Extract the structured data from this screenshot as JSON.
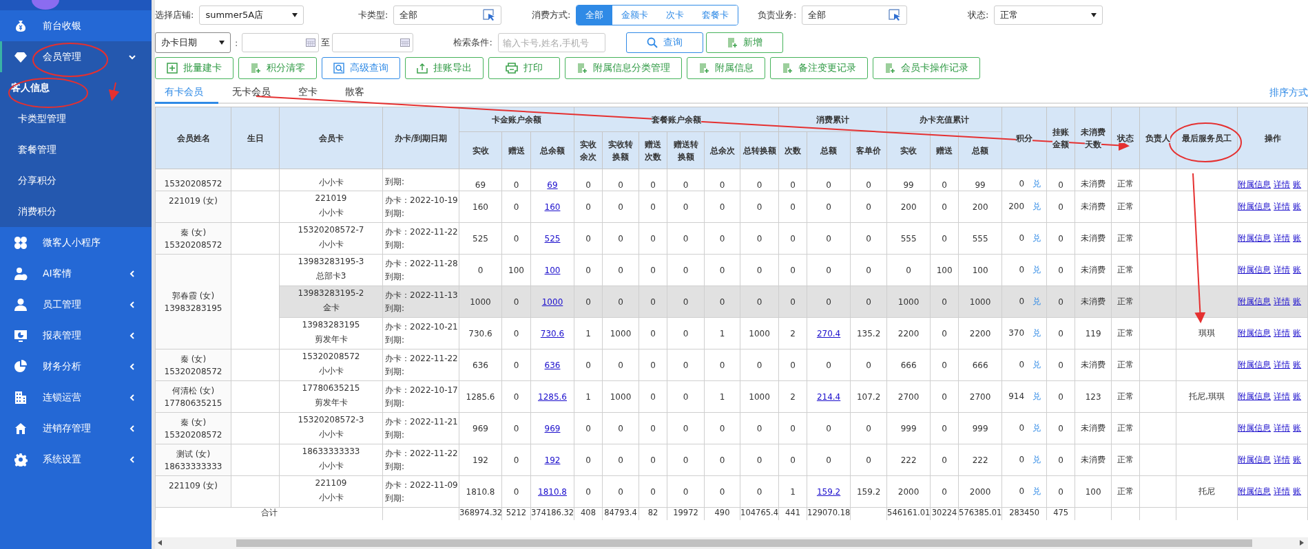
{
  "sidebar": {
    "items": [
      {
        "label": "前台收银"
      },
      {
        "label": "会员管理",
        "expanded": true,
        "children": [
          {
            "label": "客人信息",
            "selected": true
          },
          {
            "label": "卡类型管理",
            "selected": false
          },
          {
            "label": "套餐管理",
            "selected": false
          },
          {
            "label": "分享积分",
            "selected": false
          },
          {
            "label": "消费积分",
            "selected": false
          }
        ]
      },
      {
        "label": "微客人小程序"
      },
      {
        "label": "AI客情",
        "expanded": false
      },
      {
        "label": "员工管理",
        "expanded": false
      },
      {
        "label": "报表管理",
        "expanded": false
      },
      {
        "label": "财务分析",
        "expanded": false
      },
      {
        "label": "连锁运营",
        "expanded": false
      },
      {
        "label": "进销存管理",
        "expanded": false
      },
      {
        "label": "系统设置",
        "expanded": false
      }
    ]
  },
  "filters": {
    "store": {
      "label": "选择店铺:",
      "value": "summer5A店"
    },
    "card_type": {
      "label": "卡类型:",
      "value": "全部"
    },
    "consume_mode": {
      "label": "消费方式:",
      "options": [
        {
          "label": "全部",
          "selected": true
        },
        {
          "label": "金额卡",
          "selected": false
        },
        {
          "label": "次卡",
          "selected": false
        },
        {
          "label": "套餐卡",
          "selected": false
        }
      ]
    },
    "business": {
      "label": "负责业务:",
      "value": "全部"
    },
    "status": {
      "label": "状态:",
      "value": "正常"
    },
    "date_type": {
      "value": "办卡日期"
    },
    "date_separator": ":",
    "date_to": "至",
    "search": {
      "label": "检索条件:",
      "placeholder": "输入卡号,姓名,手机号"
    },
    "buttons": [
      {
        "label": "查询"
      },
      {
        "label": "新增"
      }
    ]
  },
  "toolbar": [
    {
      "label": "批量建卡"
    },
    {
      "label": "积分清零"
    },
    {
      "label": "高级查询"
    },
    {
      "label": "挂账导出"
    },
    {
      "label": "打印"
    },
    {
      "label": "附属信息分类管理"
    },
    {
      "label": "附属信息"
    },
    {
      "label": "备注变更记录"
    },
    {
      "label": "会员卡操作记录"
    }
  ],
  "tabs": [
    {
      "label": "有卡会员",
      "selected": true
    },
    {
      "label": "无卡会员",
      "selected": false
    },
    {
      "label": "空卡",
      "selected": false
    },
    {
      "label": "散客",
      "selected": false
    }
  ],
  "sort_link": "排序方式",
  "table": {
    "columns": [
      {
        "label": "会员姓名"
      },
      {
        "label": "生日"
      },
      {
        "label": "会员卡"
      },
      {
        "label": "办卡/到期日期"
      },
      {
        "label": "卡金账户余额",
        "children": [
          "实收",
          "赠送",
          "总余额"
        ]
      },
      {
        "label": "套餐账户余额",
        "children": [
          "实收余次",
          "实收转换额",
          "赠送次数",
          "赠送转换额",
          "总余次",
          "总转换额"
        ]
      },
      {
        "label": "消费累计",
        "children": [
          "次数",
          "总额",
          "客单价"
        ]
      },
      {
        "label": "办卡充值累计",
        "children": [
          "实收",
          "赠送",
          "总额"
        ]
      },
      {
        "label": "积分"
      },
      {
        "label": "挂账金额"
      },
      {
        "label": "未消费天数"
      },
      {
        "label": "状态"
      },
      {
        "label": "负责人"
      },
      {
        "label": "最后服务员工"
      },
      {
        "label": "操作"
      }
    ],
    "members": [
      {
        "phone": "15320208572",
        "cards": [
          {
            "type": "小小卡",
            "expiry": "到期:",
            "balance": [
              "69",
              "0"
            ],
            "balance_total": "69",
            "package": [
              "0",
              "0",
              "0",
              "0",
              "0",
              "0"
            ],
            "visits": "0",
            "spent": "0",
            "spent_link": false,
            "avg": "0",
            "recharge": [
              "99",
              "0",
              "99"
            ],
            "points": "0",
            "exchange": "兑",
            "credit": "0",
            "idle": "未消费",
            "status": "正常",
            "actions": [
              "附属信息",
              "详情",
              "账"
            ],
            "highlighted": false
          }
        ]
      },
      {
        "name": "221019 (女)",
        "cards": [
          {
            "number": "221019",
            "type": "小小卡",
            "opened": "办卡：2022-10-19",
            "expiry": "到期:",
            "balance": [
              "160",
              "0"
            ],
            "balance_total": "160",
            "package": [
              "0",
              "0",
              "0",
              "0",
              "0",
              "0"
            ],
            "visits": "0",
            "spent": "0",
            "spent_link": false,
            "avg": "0",
            "recharge": [
              "200",
              "0",
              "200"
            ],
            "points": "200",
            "exchange": "兑",
            "credit": "0",
            "idle": "未消费",
            "status": "正常",
            "actions": [
              "附属信息",
              "详情",
              "账"
            ],
            "highlighted": false
          }
        ]
      },
      {
        "name": "秦 (女)",
        "phone": "15320208572",
        "cards": [
          {
            "number": "15320208572-7",
            "type": "小小卡",
            "opened": "办卡：2022-11-22",
            "expiry": "到期:",
            "balance": [
              "525",
              "0"
            ],
            "balance_total": "525",
            "package": [
              "0",
              "0",
              "0",
              "0",
              "0",
              "0"
            ],
            "visits": "0",
            "spent": "0",
            "spent_link": false,
            "avg": "0",
            "recharge": [
              "555",
              "0",
              "555"
            ],
            "points": "0",
            "exchange": "兑",
            "credit": "0",
            "idle": "未消费",
            "status": "正常",
            "actions": [
              "附属信息",
              "详情",
              "账"
            ],
            "highlighted": false
          }
        ]
      },
      {
        "name": "郭春霞 (女)",
        "phone": "13983283195",
        "cards": [
          {
            "number": "13983283195-3",
            "type": "总部卡3",
            "opened": "办卡：2022-11-28",
            "expiry": "到期:",
            "balance": [
              "0",
              "100"
            ],
            "balance_total": "100",
            "package": [
              "0",
              "0",
              "0",
              "0",
              "0",
              "0"
            ],
            "visits": "0",
            "spent": "0",
            "spent_link": false,
            "avg": "0",
            "recharge": [
              "0",
              "100",
              "100"
            ],
            "points": "0",
            "exchange": "兑",
            "credit": "0",
            "idle": "未消费",
            "status": "正常",
            "actions": [
              "附属信息",
              "详情",
              "账"
            ],
            "highlighted": false
          },
          {
            "number": "13983283195-2",
            "type": "金卡",
            "opened": "办卡：2022-11-13",
            "expiry": "到期:",
            "balance": [
              "1000",
              "0"
            ],
            "balance_total": "1000",
            "package": [
              "0",
              "0",
              "0",
              "0",
              "0",
              "0"
            ],
            "visits": "0",
            "spent": "0",
            "spent_link": false,
            "avg": "0",
            "recharge": [
              "1000",
              "0",
              "1000"
            ],
            "points": "0",
            "exchange": "兑",
            "credit": "0",
            "idle": "未消费",
            "status": "正常",
            "actions": [
              "附属信息",
              "详情",
              "账"
            ],
            "highlighted": true
          },
          {
            "number": "13983283195",
            "type": "剪发年卡",
            "opened": "办卡：2022-10-21",
            "expiry": "到期:",
            "balance": [
              "730.6",
              "0"
            ],
            "balance_total": "730.6",
            "package": [
              "1",
              "1000",
              "0",
              "0",
              "1",
              "1000"
            ],
            "visits": "2",
            "spent": "270.4",
            "spent_link": true,
            "avg": "135.2",
            "recharge": [
              "2200",
              "0",
              "2200"
            ],
            "points": "370",
            "exchange": "兑",
            "credit": "0",
            "idle": "119",
            "status": "正常",
            "staff": "琪琪",
            "actions": [
              "附属信息",
              "详情",
              "账"
            ],
            "highlighted": false
          }
        ]
      },
      {
        "name": "秦 (女)",
        "phone": "15320208572",
        "cards": [
          {
            "number": "15320208572",
            "type": "小小卡",
            "opened": "办卡：2022-11-22",
            "expiry": "到期:",
            "balance": [
              "636",
              "0"
            ],
            "balance_total": "636",
            "package": [
              "0",
              "0",
              "0",
              "0",
              "0",
              "0"
            ],
            "visits": "0",
            "spent": "0",
            "spent_link": false,
            "avg": "0",
            "recharge": [
              "666",
              "0",
              "666"
            ],
            "points": "0",
            "exchange": "兑",
            "credit": "0",
            "idle": "未消费",
            "status": "正常",
            "actions": [
              "附属信息",
              "详情",
              "账"
            ],
            "highlighted": false
          }
        ]
      },
      {
        "name": "何清松 (女)",
        "phone": "17780635215",
        "cards": [
          {
            "number": "17780635215",
            "type": "剪发年卡",
            "opened": "办卡：2022-10-17",
            "expiry": "到期:",
            "balance": [
              "1285.6",
              "0"
            ],
            "balance_total": "1285.6",
            "package": [
              "1",
              "1000",
              "0",
              "0",
              "1",
              "1000"
            ],
            "visits": "2",
            "spent": "214.4",
            "spent_link": true,
            "avg": "107.2",
            "recharge": [
              "2700",
              "0",
              "2700"
            ],
            "points": "914",
            "exchange": "兑",
            "credit": "0",
            "idle": "123",
            "status": "正常",
            "staff": "托尼,琪琪",
            "actions": [
              "附属信息",
              "详情",
              "账"
            ],
            "highlighted": false
          }
        ]
      },
      {
        "name": "秦 (女)",
        "phone": "15320208572",
        "cards": [
          {
            "number": "15320208572-3",
            "type": "小小卡",
            "opened": "办卡：2022-11-21",
            "expiry": "到期:",
            "balance": [
              "969",
              "0"
            ],
            "balance_total": "969",
            "package": [
              "0",
              "0",
              "0",
              "0",
              "0",
              "0"
            ],
            "visits": "0",
            "spent": "0",
            "spent_link": false,
            "avg": "0",
            "recharge": [
              "999",
              "0",
              "999"
            ],
            "points": "0",
            "exchange": "兑",
            "credit": "0",
            "idle": "未消费",
            "status": "正常",
            "actions": [
              "附属信息",
              "详情",
              "账"
            ],
            "highlighted": false
          }
        ]
      },
      {
        "name": "测试 (女)",
        "phone": "18633333333",
        "cards": [
          {
            "number": "18633333333",
            "type": "小小卡",
            "opened": "办卡：2022-11-22",
            "expiry": "到期:",
            "balance": [
              "192",
              "0"
            ],
            "balance_total": "192",
            "package": [
              "0",
              "0",
              "0",
              "0",
              "0",
              "0"
            ],
            "visits": "0",
            "spent": "0",
            "spent_link": false,
            "avg": "0",
            "recharge": [
              "222",
              "0",
              "222"
            ],
            "points": "0",
            "exchange": "兑",
            "credit": "0",
            "idle": "未消费",
            "status": "正常",
            "actions": [
              "附属信息",
              "详情",
              "账"
            ],
            "highlighted": false
          }
        ]
      },
      {
        "name": "221109 (女)",
        "cards": [
          {
            "number": "221109",
            "type": "小小卡",
            "opened": "办卡：2022-11-09",
            "expiry": "到期:",
            "balance": [
              "1810.8",
              "0"
            ],
            "balance_total": "1810.8",
            "package": [
              "0",
              "0",
              "0",
              "0",
              "0",
              "0"
            ],
            "visits": "1",
            "spent": "159.2",
            "spent_link": true,
            "avg": "159.2",
            "recharge": [
              "2000",
              "0",
              "2000"
            ],
            "points": "0",
            "exchange": "兑",
            "credit": "0",
            "idle": "100",
            "status": "正常",
            "staff": "托尼",
            "actions": [
              "附属信息",
              "详情",
              "账"
            ],
            "highlighted": false
          }
        ]
      }
    ],
    "totals": {
      "label": "合计",
      "balance": [
        "368974.32",
        "5212",
        "374186.32"
      ],
      "package": [
        "408",
        "84793.4",
        "82",
        "19972",
        "490",
        "104765.4"
      ],
      "consume": [
        "441",
        "129070.18"
      ],
      "recharge": [
        "546161.01",
        "30224",
        "576385.01"
      ],
      "points": "283450",
      "credit": "475"
    }
  }
}
